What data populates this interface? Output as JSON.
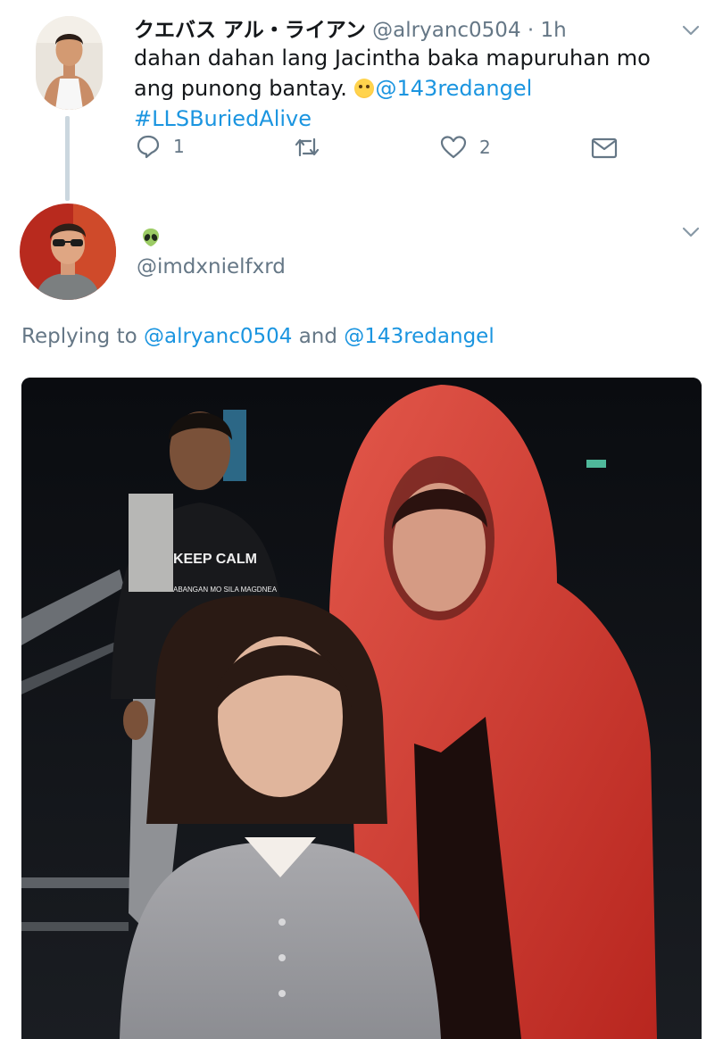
{
  "parent_tweet": {
    "display_name": "クエバス アル・ライアン",
    "handle": "@alryanc0504",
    "separator": "·",
    "time": "1h",
    "text_part1": "dahan dahan lang Jacintha baka mapuruhan mo ang punong bantay.",
    "emoji_icon": "face-emoji-icon",
    "mention": "@143redangel",
    "hashtag": "#LLSBuriedAlive",
    "reply_count": "1",
    "like_count": "2"
  },
  "reply_tweet": {
    "display_name_icon": "alien-emoji-icon",
    "handle": "@imdxnielfxrd",
    "replying_prefix": "Replying to",
    "replying_user1": "@alryanc0504",
    "replying_and": "and",
    "replying_user2": "@143redangel",
    "media_shirt_text": "KEEP CALM",
    "media_shirt_sub": "ABANGAN MO SILA MAGDNEA"
  },
  "colors": {
    "link": "#1b95e0",
    "muted": "#657786",
    "text": "#14171a",
    "thread_line": "#cbd7df"
  }
}
